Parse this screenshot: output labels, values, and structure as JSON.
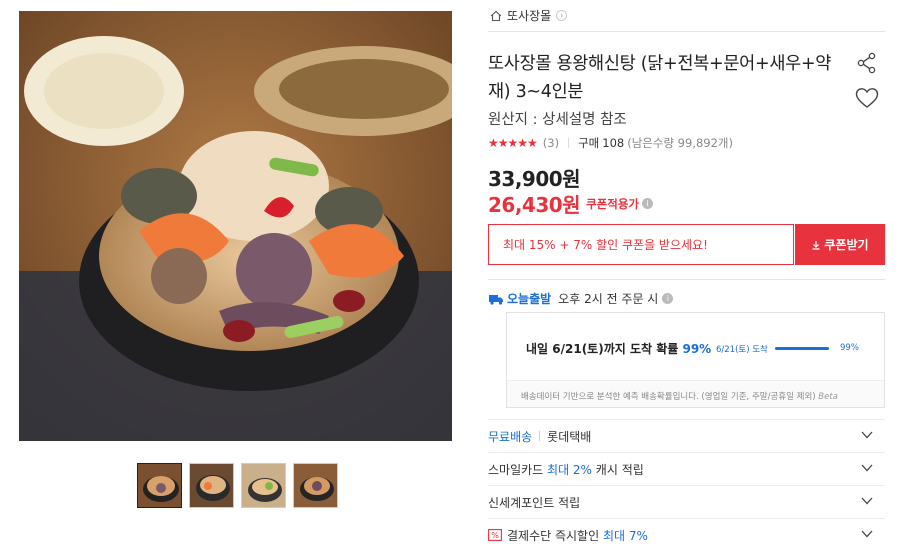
{
  "images": {
    "main_alt": "용왕해신탕 상품 이미지",
    "thumbnail_count": 4
  },
  "breadcrumb": {
    "store": "또사장몰"
  },
  "product": {
    "title": "또사장몰 용왕해신탕 (닭+전복+문어+새우+약재) 3~4인분",
    "origin": "원산지 : 상세설명 참조",
    "stars": "★★★★★",
    "review_count": "(3)",
    "purchase_label": "구매",
    "purchase_count": "108",
    "stock_note": "(남은수량 99,892개)",
    "price_original": "33,900원",
    "price_sale": "26,430원",
    "coupon_applied_label": "쿠폰적용가"
  },
  "coupon": {
    "message": "최대 15% + 7% 할인 쿠폰을 받으세요!",
    "button_label": "쿠폰받기"
  },
  "delivery": {
    "label": "오늘출발",
    "text": "오후 2시 전 주문 시",
    "forecast_main": "내일 6/21(토)까지 도착 확률",
    "forecast_pct": "99%",
    "chart_date": "6/21(토) 도착",
    "chart_pct": "99%",
    "note": "배송데이터 기반으로 분석한 예측 배송확률입니다. (영업일 기준, 주말/공휴일 제외)",
    "beta": "Beta"
  },
  "accordion": {
    "shipping_free": "무료배송",
    "shipping_company": "롯데택배",
    "smilecard": "스마일카드",
    "smilecard_highlight": "최대 2%",
    "smilecard_tail": "캐시 적립",
    "shinsegae": "신세계포인트 적립",
    "payment": "결제수단 즉시할인",
    "payment_highlight": "최대 7%"
  },
  "colors": {
    "accent_red": "#e8323d",
    "accent_blue": "#1a6fd8"
  }
}
